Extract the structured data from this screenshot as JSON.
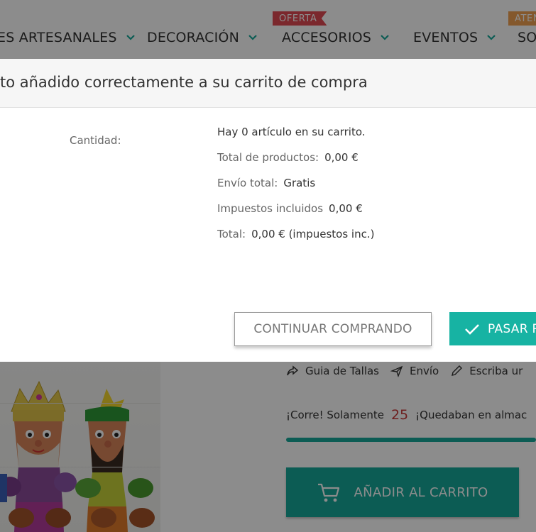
{
  "nav": {
    "items": [
      {
        "label": "ES ARTESANALES"
      },
      {
        "label": "DECORACIÓN"
      },
      {
        "label": "ACCESORIOS"
      },
      {
        "label": "EVENTOS"
      },
      {
        "label": "SO"
      }
    ],
    "badges": [
      {
        "label": "OFERTA",
        "color": "#e04a52"
      },
      {
        "label": "ATEN",
        "color": "#f0a050"
      }
    ]
  },
  "modal": {
    "title": "to añadido correctamente a su carrito de compra",
    "quantity_label": "Cantidad:",
    "cart_count_text": "Hay 0 artículo en su carrito.",
    "products_total_label": "Total de productos:",
    "products_total_value": "0,00 €",
    "shipping_label": "Envío total:",
    "shipping_value": "Gratis",
    "taxes_label": "Impuestos incluidos",
    "taxes_value": "0,00 €",
    "total_label": "Total:",
    "total_value": "0,00 € (impuestos inc.)",
    "continue_button": "CONTINUAR COMPRANDO",
    "checkout_button": "PASAR P"
  },
  "page": {
    "links": [
      {
        "label": "Guia de Tallas",
        "icon": "share-icon"
      },
      {
        "label": "Envío",
        "icon": "plane-icon"
      },
      {
        "label": "Escriba ur",
        "icon": "pencil-icon"
      }
    ],
    "stock_prefix": "¡Corre! Solamente",
    "stock_count": "25",
    "stock_suffix": "¡Quedaban en almac",
    "add_to_cart_button": "AÑADIR AL CARRITO"
  },
  "colors": {
    "accent": "#17a89a",
    "stock_number": "#c83a3a"
  }
}
